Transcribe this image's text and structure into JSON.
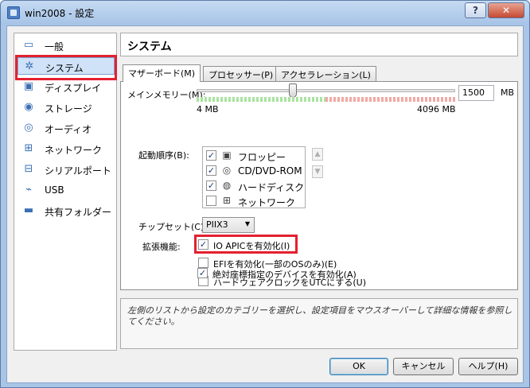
{
  "window": {
    "title": "win2008 - 設定",
    "help_label": "?",
    "close_label": "✕"
  },
  "sidebar": {
    "items": [
      {
        "label": "一般",
        "icon": "general-icon"
      },
      {
        "label": "システム",
        "icon": "system-icon",
        "selected": true
      },
      {
        "label": "ディスプレイ",
        "icon": "display-icon"
      },
      {
        "label": "ストレージ",
        "icon": "storage-icon"
      },
      {
        "label": "オーディオ",
        "icon": "audio-icon"
      },
      {
        "label": "ネットワーク",
        "icon": "network-icon"
      },
      {
        "label": "シリアルポート",
        "icon": "serial-port-icon"
      },
      {
        "label": "USB",
        "icon": "usb-icon"
      },
      {
        "label": "共有フォルダー",
        "icon": "shared-folder-icon"
      }
    ]
  },
  "panel": {
    "title": "システム"
  },
  "tabs": [
    {
      "label": "マザーボード(M)",
      "active": true
    },
    {
      "label": "プロセッサー(P)",
      "active": false
    },
    {
      "label": "アクセラレーション(L)",
      "active": false
    }
  ],
  "memory": {
    "label": "メインメモリー(M):",
    "value": "1500",
    "unit": "MB",
    "min_label": "4 MB",
    "max_label": "4096 MB",
    "slider_fraction": 0.366
  },
  "boot": {
    "label": "起動順序(B):",
    "items": [
      {
        "label": "フロッピー",
        "checked": true,
        "icon": "floppy-icon"
      },
      {
        "label": "CD/DVD-ROM",
        "checked": true,
        "icon": "cd-icon"
      },
      {
        "label": "ハードディスク",
        "checked": true,
        "icon": "hard-disk-icon"
      },
      {
        "label": "ネットワーク",
        "checked": false,
        "icon": "network-icon"
      }
    ],
    "up_glyph": "▲",
    "down_glyph": "▼"
  },
  "chipset": {
    "label": "チップセット(C):",
    "value": "PIIX3"
  },
  "extended": {
    "label": "拡張機能:",
    "options": [
      {
        "label": "IO APICを有効化(I)",
        "checked": true
      },
      {
        "label": "EFIを有効化(一部のOSのみ)(E)",
        "checked": false
      },
      {
        "label": "ハードウェアクロックをUTCにする(U)",
        "checked": false
      },
      {
        "label": "絶対座標指定のデバイスを有効化(A)",
        "checked": true
      }
    ]
  },
  "description": "左側のリストから設定のカテゴリーを選択し、設定項目をマウスオーバーして詳細な情報を参照してください。",
  "buttons": {
    "ok": "OK",
    "cancel": "キャンセル",
    "help": "ヘルプ(H)"
  },
  "colors": {
    "highlight": "#e3202f",
    "selection": "#cfe2f7"
  }
}
